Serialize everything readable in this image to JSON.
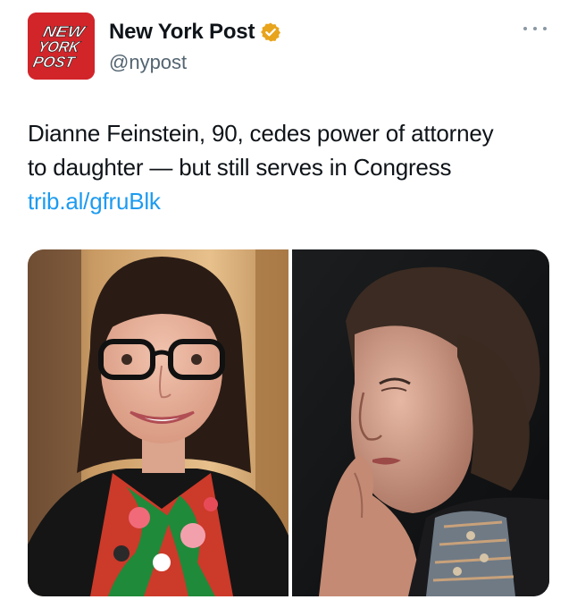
{
  "account": {
    "display_name": "New York Post",
    "handle": "@nypost",
    "logo_text": [
      "NEW",
      "YORK",
      "POST"
    ],
    "verified": true,
    "verified_icon": "verified-badge-icon",
    "brand_color": "#d1252a",
    "badge_color": "#e8a41c"
  },
  "tweet": {
    "text_lines": [
      "Dianne Feinstein, 90, cedes power of attorney",
      "to daughter — but still serves in Congress"
    ],
    "link": "trib.al/gfruBlk",
    "link_color": "#1d9bf0"
  },
  "menu": {
    "icon": "more-options-icon"
  },
  "media": {
    "count": 2,
    "items": [
      {
        "name": "photo-left",
        "subject": "smiling woman with glasses and floral scarf"
      },
      {
        "name": "photo-right",
        "subject": "elderly woman resting chin on hand"
      }
    ]
  }
}
